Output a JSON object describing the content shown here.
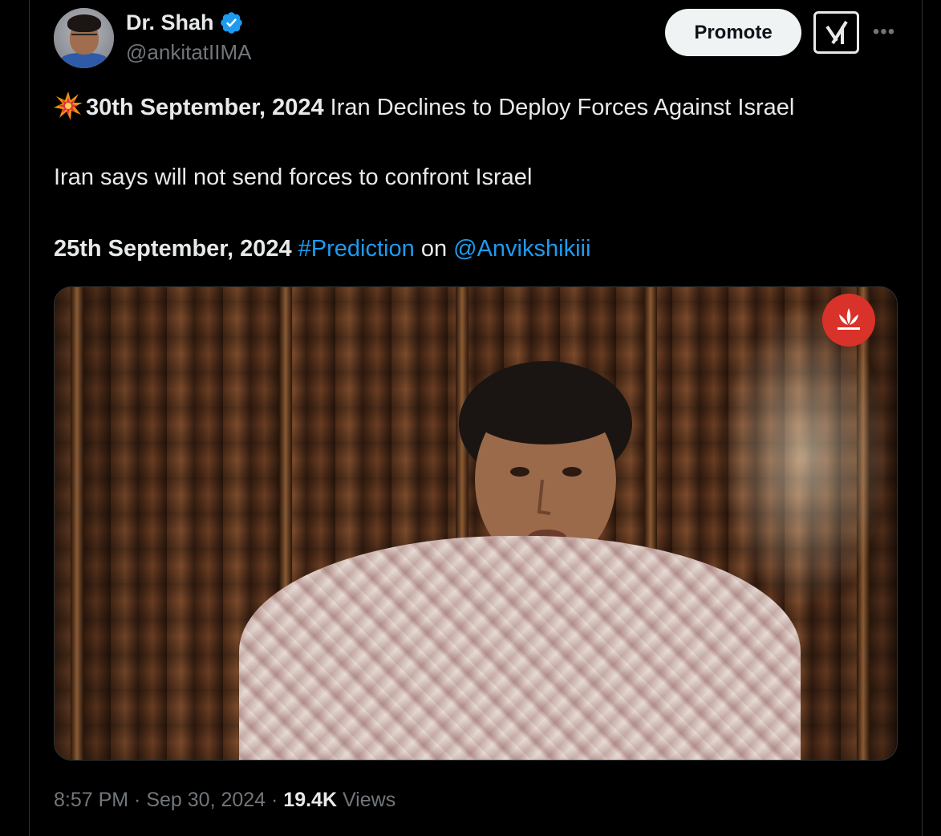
{
  "author": {
    "name": "Dr. Shah",
    "handle": "@ankitatIIMA",
    "verified": true
  },
  "actions": {
    "promote_label": "Promote",
    "grok_icon": "grok-icon",
    "more_icon": "more-icon"
  },
  "post": {
    "line1_date": "30th September, 2024",
    "line1_text": " Iran Declines to Deploy Forces Against Israel",
    "line2_text": "Iran says will not send forces to confront Israel",
    "line3_date": "25th September, 2024",
    "line3_hashtag": "#Prediction",
    "line3_on": " on ",
    "line3_mention": "@Anvikshikiii"
  },
  "media": {
    "type": "video"
  },
  "meta": {
    "time": "8:57 PM",
    "separator": " · ",
    "date": "Sep 30, 2024",
    "views_count": "19.4K",
    "views_label": " Views"
  },
  "colors": {
    "link": "#1d9bf0",
    "verified": "#1d9bf0",
    "muted": "#71767b",
    "text": "#e7e9ea",
    "background": "#000000"
  }
}
